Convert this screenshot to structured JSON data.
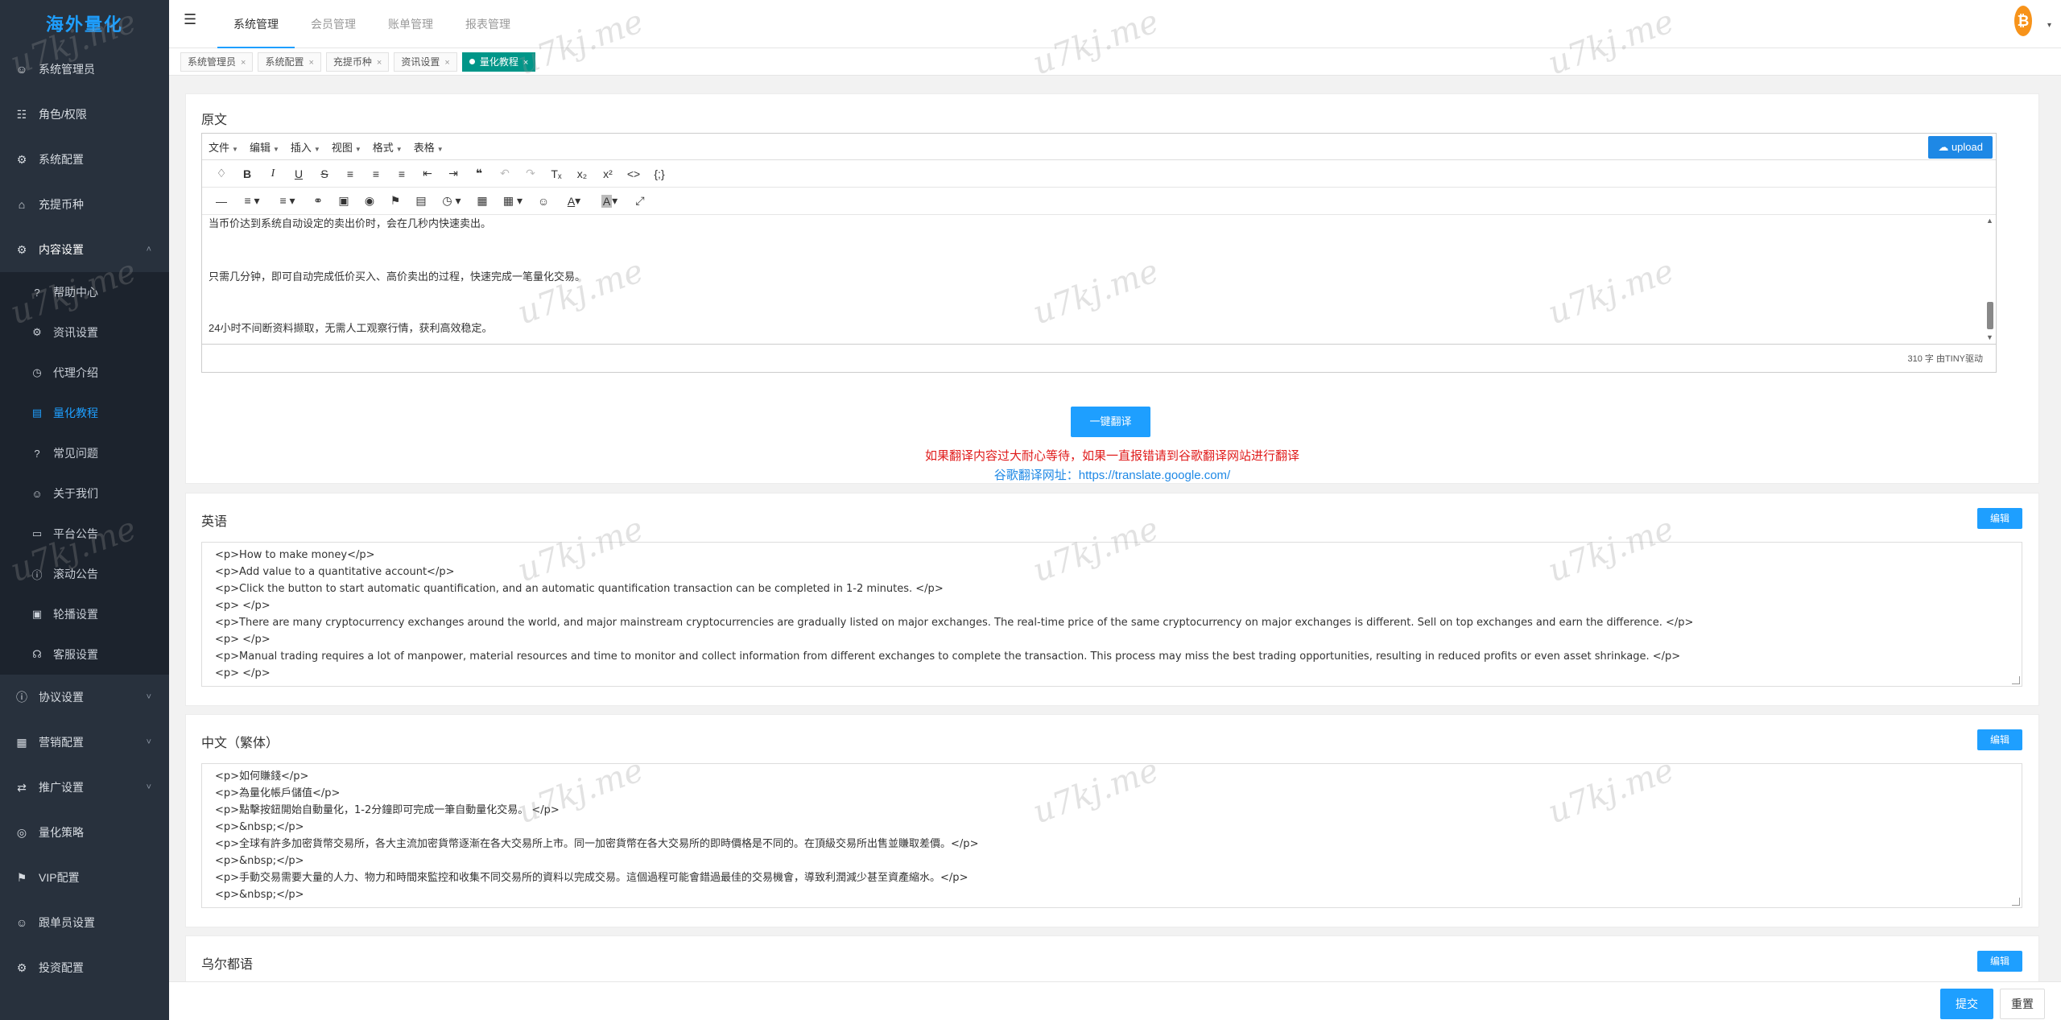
{
  "brand": "海外量化",
  "sidebar": {
    "items": [
      {
        "label": "系统管理员",
        "icon": "user-icon"
      },
      {
        "label": "角色/权限",
        "icon": "org-icon"
      },
      {
        "label": "系统配置",
        "icon": "gear-icon"
      },
      {
        "label": "充提币种",
        "icon": "shop-icon"
      },
      {
        "label": "内容设置",
        "icon": "gear-icon"
      }
    ],
    "sub_items": [
      {
        "label": "帮助中心",
        "icon": "question-icon"
      },
      {
        "label": "资讯设置",
        "icon": "gear-icon"
      },
      {
        "label": "代理介绍",
        "icon": "clock-icon"
      },
      {
        "label": "量化教程",
        "icon": "book-icon"
      },
      {
        "label": "常见问题",
        "icon": "question-icon"
      },
      {
        "label": "关于我们",
        "icon": "user-icon"
      },
      {
        "label": "平台公告",
        "icon": "monitor-icon"
      },
      {
        "label": "滚动公告",
        "icon": "info-icon"
      },
      {
        "label": "轮播设置",
        "icon": "image-icon"
      },
      {
        "label": "客服设置",
        "icon": "headset-icon"
      }
    ],
    "items_after": [
      {
        "label": "协议设置",
        "icon": "info-icon"
      },
      {
        "label": "营销配置",
        "icon": "chart-icon"
      },
      {
        "label": "推广设置",
        "icon": "share-icon"
      },
      {
        "label": "量化策略",
        "icon": "coin-icon"
      },
      {
        "label": "VIP配置",
        "icon": "vip-icon"
      },
      {
        "label": "跟单员设置",
        "icon": "user-icon"
      },
      {
        "label": "投资配置",
        "icon": "gear-icon"
      }
    ]
  },
  "header": {
    "tabs": [
      "系统管理",
      "会员管理",
      "账单管理",
      "报表管理"
    ],
    "active_tab": "系统管理",
    "coin_symbol": "₿"
  },
  "page_tabs": [
    "系统管理员",
    "系统配置",
    "充提币种",
    "资讯设置",
    "量化教程"
  ],
  "original": {
    "title": "原文",
    "menus": [
      "文件",
      "编辑",
      "插入",
      "视图",
      "格式",
      "表格"
    ],
    "upload_label": "upload",
    "lines": [
      "当币价达到系统自动设定的卖出价时，会在几秒内快速卖出。",
      "只需几分钟，即可自动完成低价买入、高价卖出的过程，快速完成一笔量化交易。",
      "24小时不间断资料撷取，无需人工观察行情，获利高效稳定。"
    ],
    "word_count": "310 字",
    "powered_by": "由TINY驱动"
  },
  "translate": {
    "button": "一键翻译",
    "warning": "如果翻译内容过大耐心等待，如果一直报错请到谷歌翻译网站进行翻译",
    "link_label": "谷歌翻译网址：",
    "link_url": "https://translate.google.com/"
  },
  "english": {
    "title": "英语",
    "edit": "编辑",
    "lines": [
      "<p>How to make money</p>",
      "<p>Add value to a quantitative account</p>",
      "<p>Click the button to start automatic quantification, and an automatic quantification transaction can be completed in 1-2 minutes. </p>",
      "<p> </p>",
      "<p>There are many cryptocurrency exchanges around the world, and major mainstream cryptocurrencies are gradually listed on major exchanges. The real-time price of the same cryptocurrency on major exchanges is different. Sell on top exchanges and earn the difference. </p>",
      "<p> </p>",
      "<p>Manual trading requires a lot of manpower, material resources and time to monitor and collect information from different exchanges to complete the transaction. This process may miss the best trading opportunities, resulting in reduced profits or even asset shrinkage. </p>",
      "<p> </p>"
    ]
  },
  "traditional": {
    "title": "中文（繁体）",
    "edit": "编辑",
    "lines": [
      "<p>如何賺錢</p>",
      "<p>為量化帳戶儲值</p>",
      "<p>點擊按鈕開始自動量化，1-2分鐘即可完成一筆自動量化交易。 </p>",
      "<p>&nbsp;</p>",
      "<p>全球有許多加密貨幣交易所，各大主流加密貨幣逐漸在各大交易所上市。同一加密貨幣在各大交易所的即時價格是不同的。在頂級交易所出售並賺取差價。</p>",
      "<p>&nbsp;</p>",
      "<p>手動交易需要大量的人力、物力和時間來監控和收集不同交易所的資料以完成交易。這個過程可能會錯過最佳的交易機會，導致利潤減少甚至資產縮水。</p>",
      "<p>&nbsp;</p>"
    ]
  },
  "urdu": {
    "title": "乌尔都语",
    "edit": "编辑"
  },
  "footer": {
    "submit": "提交",
    "reset": "重置"
  },
  "watermark": "u7kj.me"
}
